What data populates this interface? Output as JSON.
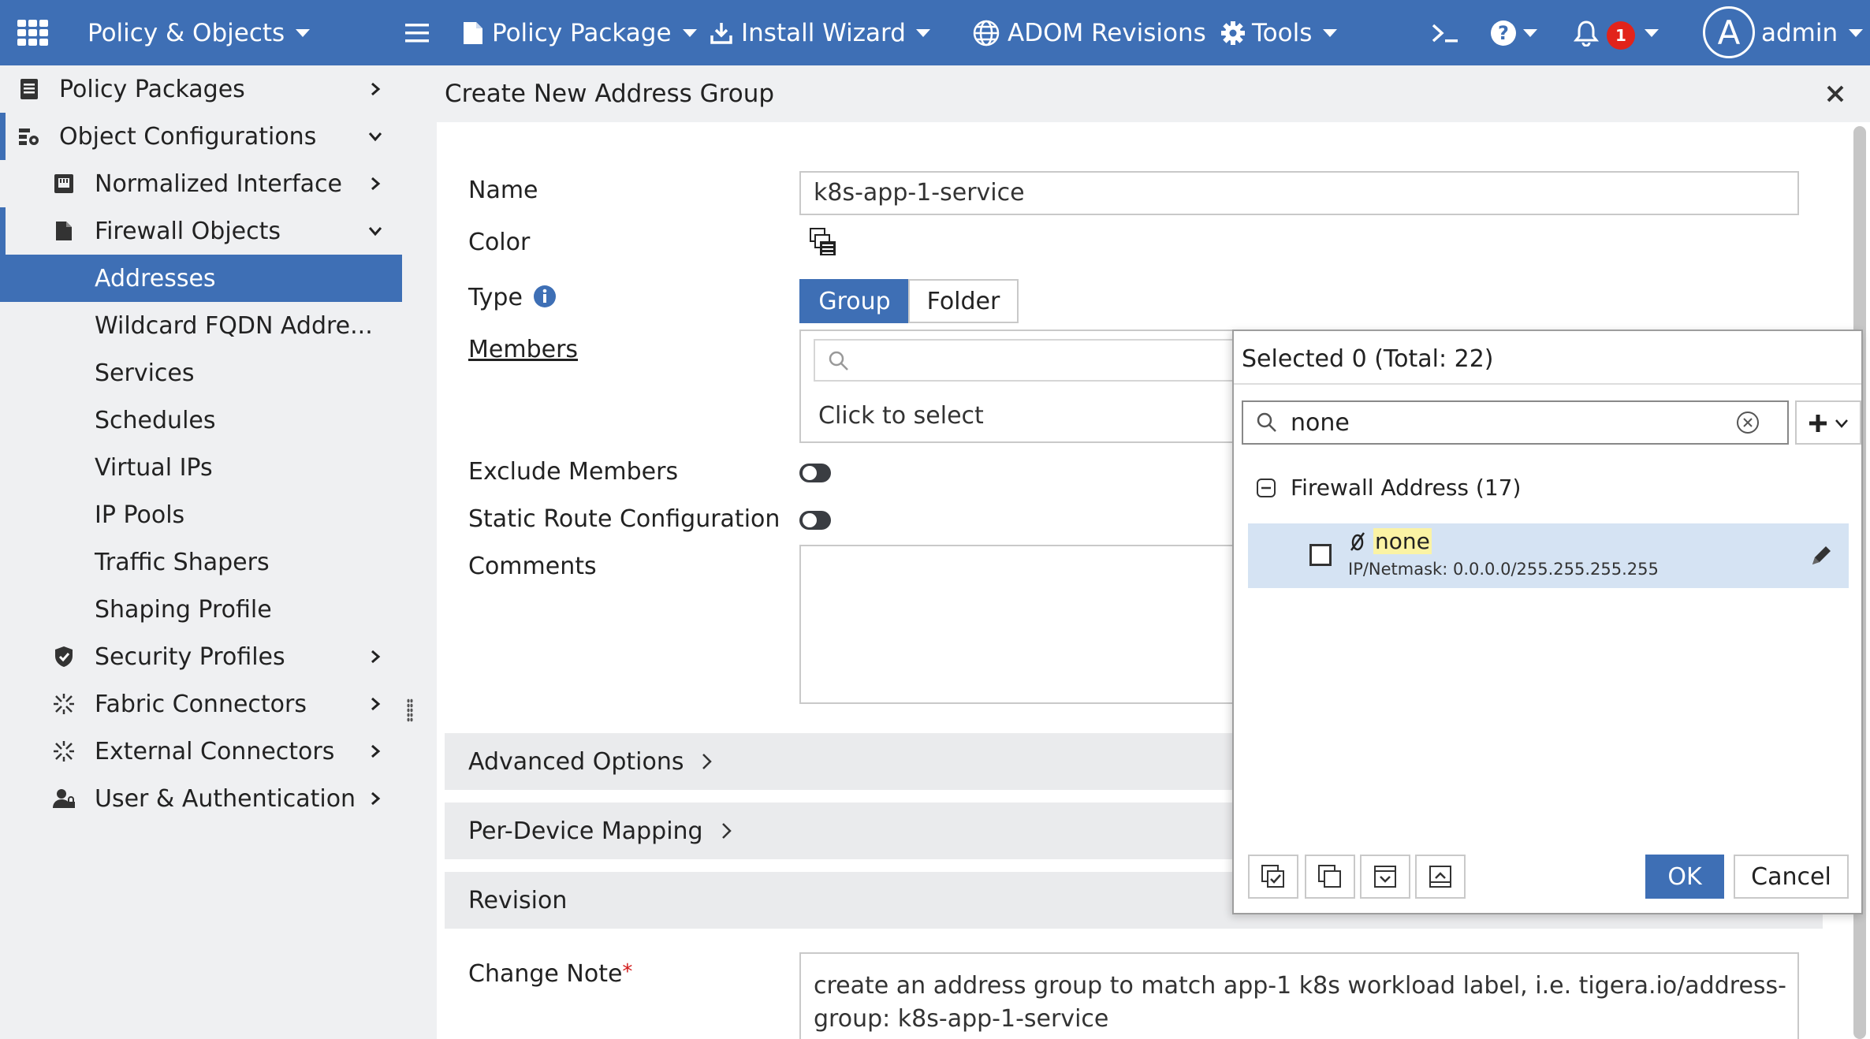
{
  "topbar": {
    "app_menu": "Policy & Objects",
    "policy_package": "Policy Package",
    "install_wizard": "Install Wizard",
    "adom_revisions": "ADOM Revisions",
    "tools": "Tools",
    "notifications_count": "1",
    "avatar_letter": "A",
    "user": "admin"
  },
  "sidebar": {
    "items": [
      {
        "label": "Policy Packages"
      },
      {
        "label": "Object Configurations"
      },
      {
        "label": "Normalized Interface"
      },
      {
        "label": "Firewall Objects"
      },
      {
        "label": "Addresses"
      },
      {
        "label": "Wildcard FQDN Addre..."
      },
      {
        "label": "Services"
      },
      {
        "label": "Schedules"
      },
      {
        "label": "Virtual IPs"
      },
      {
        "label": "IP Pools"
      },
      {
        "label": "Traffic Shapers"
      },
      {
        "label": "Shaping Profile"
      },
      {
        "label": "Security Profiles"
      },
      {
        "label": "Fabric Connectors"
      },
      {
        "label": "External Connectors"
      },
      {
        "label": "User & Authentication"
      }
    ]
  },
  "dialog": {
    "title": "Create New Address Group",
    "labels": {
      "name": "Name",
      "color": "Color",
      "type": "Type",
      "members": "Members",
      "exclude_members": "Exclude Members",
      "static_route": "Static Route Configuration",
      "comments": "Comments",
      "change_note": "Change Note",
      "required_mark": "*"
    },
    "name_value": "k8s-app-1-service",
    "type_options": [
      "Group",
      "Folder"
    ],
    "type_selected": "Group",
    "members_placeholder": "Click to select",
    "sections": [
      "Advanced Options",
      "Per-Device Mapping",
      "Revision"
    ],
    "change_note_value": "create an address group to match app-1 k8s workload label, i.e. tigera.io/address-group: k8s-app-1-service"
  },
  "selector": {
    "header": "Selected 0 (Total: 22)",
    "search_value": "none",
    "group_label": "Firewall Address (17)",
    "items": [
      {
        "name": "none",
        "detail": "IP/Netmask: 0.0.0.0/255.255.255.255",
        "checked": false
      }
    ],
    "ok_label": "OK",
    "cancel_label": "Cancel"
  },
  "colors": {
    "brand_blue": "#3e6fb5",
    "sidebar_bg": "#eff0f2",
    "highlight_row": "#d5e3f3",
    "search_highlight": "#fbf3a4",
    "badge_red": "#e2231a"
  }
}
